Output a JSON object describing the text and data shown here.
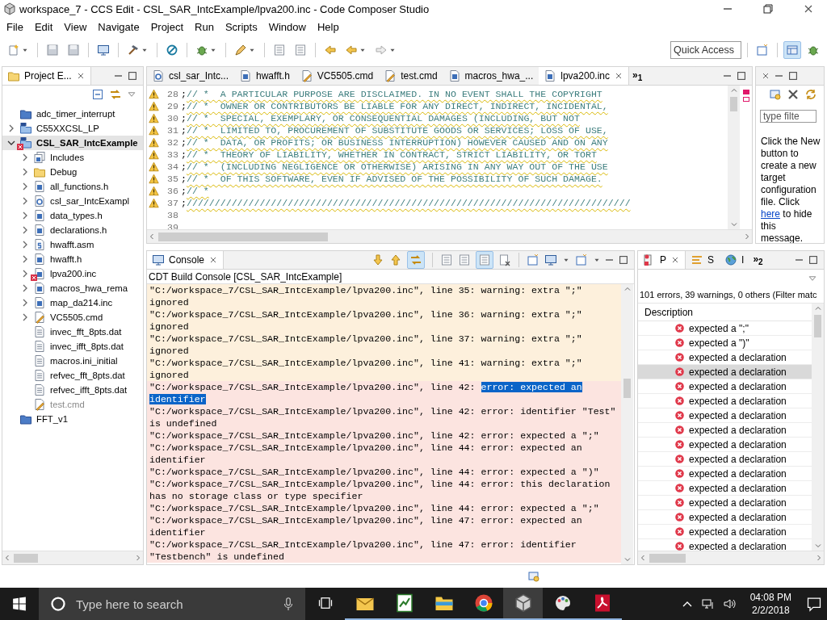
{
  "window": {
    "title": "workspace_7 - CCS Edit - CSL_SAR_IntcExample/lpva200.inc - Code Composer Studio"
  },
  "menu": [
    "File",
    "Edit",
    "View",
    "Navigate",
    "Project",
    "Run",
    "Scripts",
    "Window",
    "Help"
  ],
  "toolbar": {
    "quick_access": {
      "placeholder": "Quick Access"
    }
  },
  "project_explorer": {
    "title": "Project E...",
    "items": [
      {
        "label": "adc_timer_interrupt",
        "kind": "closed-project",
        "selected": false,
        "error": false,
        "excluded": false
      },
      {
        "label": "C55XXCSL_LP",
        "kind": "project",
        "expanded": false,
        "selected": false,
        "error": false,
        "excluded": false
      },
      {
        "label": "CSL_SAR_IntcExample",
        "kind": "project",
        "expanded": true,
        "selected": true,
        "error": true,
        "excluded": false,
        "children": [
          {
            "label": "Includes",
            "kind": "includes",
            "expanded": false,
            "selected": false,
            "error": false,
            "excluded": false
          },
          {
            "label": "Debug",
            "kind": "folder",
            "expanded": false,
            "selected": false,
            "error": false,
            "excluded": false
          },
          {
            "label": "all_functions.h",
            "kind": "h",
            "expanded": false,
            "selected": false,
            "error": false,
            "excluded": false
          },
          {
            "label": "csl_sar_IntcExampl",
            "kind": "c",
            "expanded": false,
            "selected": false,
            "error": false,
            "excluded": false
          },
          {
            "label": "data_types.h",
            "kind": "h",
            "expanded": false,
            "selected": false,
            "error": false,
            "excluded": false
          },
          {
            "label": "declarations.h",
            "kind": "h",
            "expanded": false,
            "selected": false,
            "error": false,
            "excluded": false
          },
          {
            "label": "hwafft.asm",
            "kind": "s",
            "expanded": false,
            "selected": false,
            "error": false,
            "excluded": false
          },
          {
            "label": "hwafft.h",
            "kind": "h",
            "expanded": false,
            "selected": false,
            "error": false,
            "excluded": false
          },
          {
            "label": "lpva200.inc",
            "kind": "h",
            "expanded": false,
            "selected": false,
            "error": true,
            "excluded": false
          },
          {
            "label": "macros_hwa_rema",
            "kind": "h",
            "expanded": false,
            "selected": false,
            "error": false,
            "excluded": false
          },
          {
            "label": "map_da214.inc",
            "kind": "h",
            "expanded": false,
            "selected": false,
            "error": false,
            "excluded": false
          },
          {
            "label": "VC5505.cmd",
            "kind": "cmd",
            "expanded": false,
            "selected": false,
            "error": false,
            "excluded": false
          },
          {
            "label": "invec_fft_8pts.dat",
            "kind": "dat",
            "selected": false,
            "error": false,
            "excluded": false
          },
          {
            "label": "invec_ifft_8pts.dat",
            "kind": "dat",
            "selected": false,
            "error": false,
            "excluded": false
          },
          {
            "label": "macros.ini_initial",
            "kind": "dat",
            "selected": false,
            "error": false,
            "excluded": false
          },
          {
            "label": "refvec_fft_8pts.dat",
            "kind": "dat",
            "selected": false,
            "error": false,
            "excluded": false
          },
          {
            "label": "refvec_ifft_8pts.dat",
            "kind": "dat",
            "selected": false,
            "error": false,
            "excluded": false
          },
          {
            "label": "test.cmd",
            "kind": "cmd",
            "selected": false,
            "error": false,
            "excluded": true
          }
        ]
      },
      {
        "label": "FFT_v1",
        "kind": "closed-project",
        "selected": false,
        "error": false,
        "excluded": false
      }
    ]
  },
  "editor": {
    "tabs": [
      {
        "label": "csl_sar_Intc...",
        "kind": "c",
        "selected": false
      },
      {
        "label": "hwafft.h",
        "kind": "h",
        "selected": false
      },
      {
        "label": "VC5505.cmd",
        "kind": "cmd",
        "selected": false
      },
      {
        "label": "test.cmd",
        "kind": "cmd",
        "selected": false
      },
      {
        "label": "macros_hwa_...",
        "kind": "h",
        "selected": false
      },
      {
        "label": "lpva200.inc",
        "kind": "h",
        "selected": true
      }
    ],
    "overflow": "»$_{1}$",
    "lines": [
      {
        "number": "28",
        "code": ";",
        "comment": "// *  A PARTICULAR PURPOSE ARE DISCLAIMED. IN NO EVENT SHALL THE COPYRIGHT",
        "warning": true
      },
      {
        "number": "29",
        "code": ";",
        "comment": "// *  OWNER OR CONTRIBUTORS BE LIABLE FOR ANY DIRECT, INDIRECT, INCIDENTAL,",
        "warning": true
      },
      {
        "number": "30",
        "code": ";",
        "comment": "// *  SPECIAL, EXEMPLARY, OR CONSEQUENTIAL DAMAGES (INCLUDING, BUT NOT",
        "warning": true
      },
      {
        "number": "31",
        "code": ";",
        "comment": "// *  LIMITED TO, PROCUREMENT OF SUBSTITUTE GOODS OR SERVICES; LOSS OF USE,",
        "warning": true
      },
      {
        "number": "32",
        "code": ";",
        "comment": "// *  DATA, OR PROFITS; OR BUSINESS INTERRUPTION) HOWEVER CAUSED AND ON ANY",
        "warning": true
      },
      {
        "number": "33",
        "code": ";",
        "comment": "// *  THEORY OF LIABILITY, WHETHER IN CONTRACT, STRICT LIABILITY, OR TORT",
        "warning": true
      },
      {
        "number": "34",
        "code": ";",
        "comment": "// *  (INCLUDING NEGLIGENCE OR OTHERWISE) ARISING IN ANY WAY OUT OF THE USE",
        "warning": true
      },
      {
        "number": "35",
        "code": ";",
        "comment": "// *  OF THIS SOFTWARE, EVEN IF ADVISED OF THE POSSIBILITY OF SUCH DAMAGE.",
        "warning": true
      },
      {
        "number": "36",
        "code": ";",
        "comment": "// *",
        "warning": true
      },
      {
        "number": "37",
        "code": ";",
        "comment": "///////////////////////////////////////////////////////////////////////////////",
        "warning": true
      },
      {
        "number": "38",
        "warning": false
      },
      {
        "number": "39",
        "warning": false
      }
    ]
  },
  "target_panel": {
    "filter_placeholder": "type filte",
    "message_before": "Click the New button to create a new target configuration file. Click ",
    "link": "here",
    "message_after": " to hide this message."
  },
  "console": {
    "title": "Console",
    "subtitle": "CDT Build Console [CSL_SAR_IntcExample]",
    "messages": [
      {
        "kind": "warning",
        "text": "\"C:/workspace_7/CSL_SAR_IntcExample/lpva200.inc\", line 35: warning: extra \";\" ignored"
      },
      {
        "kind": "warning",
        "text": "\"C:/workspace_7/CSL_SAR_IntcExample/lpva200.inc\", line 36: warning: extra \";\" ignored"
      },
      {
        "kind": "warning",
        "text": "\"C:/workspace_7/CSL_SAR_IntcExample/lpva200.inc\", line 37: warning: extra \";\" ignored"
      },
      {
        "kind": "warning",
        "text": "\"C:/workspace_7/CSL_SAR_IntcExample/lpva200.inc\", line 41: warning: extra \";\" ignored"
      },
      {
        "kind": "error",
        "text": "\"C:/workspace_7/CSL_SAR_IntcExample/lpva200.inc\", line 42: ",
        "highlight": [
          "error: expected an",
          "identifier"
        ]
      },
      {
        "kind": "error",
        "text": "\"C:/workspace_7/CSL_SAR_IntcExample/lpva200.inc\", line 42: error: identifier \"Test\" is undefined"
      },
      {
        "kind": "error",
        "text": "\"C:/workspace_7/CSL_SAR_IntcExample/lpva200.inc\", line 42: error: expected a \";\""
      },
      {
        "kind": "error",
        "text": "\"C:/workspace_7/CSL_SAR_IntcExample/lpva200.inc\", line 44: error: expected an identifier"
      },
      {
        "kind": "error",
        "text": "\"C:/workspace_7/CSL_SAR_IntcExample/lpva200.inc\", line 44: error: expected a \")\""
      },
      {
        "kind": "error",
        "text": "\"C:/workspace_7/CSL_SAR_IntcExample/lpva200.inc\", line 44: error: this declaration has no storage class or type specifier"
      },
      {
        "kind": "error",
        "text": "\"C:/workspace_7/CSL_SAR_IntcExample/lpva200.inc\", line 44: error: expected a \";\""
      },
      {
        "kind": "error",
        "text": "\"C:/workspace_7/CSL_SAR_IntcExample/lpva200.inc\", line 47: error: expected an identifier"
      },
      {
        "kind": "error",
        "text": "\"C:/workspace_7/CSL_SAR_IntcExample/lpva200.inc\", line 47: error: identifier \"Testbench\" is undefined"
      }
    ]
  },
  "problems": {
    "tabs": [
      {
        "label": "P",
        "kind": "problems",
        "selected": true
      },
      {
        "label": "S",
        "kind": "list",
        "selected": false
      },
      {
        "label": "I",
        "kind": "globe",
        "selected": false
      }
    ],
    "overflow": "»$_{2}$",
    "summary": "101 errors, 39 warnings, 0 others (Filter matc",
    "column": "Description",
    "rows": [
      {
        "text": "expected a \";\"",
        "selected": false
      },
      {
        "text": "expected a \")\"",
        "selected": false
      },
      {
        "text": "expected a declaration",
        "selected": false
      },
      {
        "text": "expected a declaration",
        "selected": true
      },
      {
        "text": "expected a declaration",
        "selected": false
      },
      {
        "text": "expected a declaration",
        "selected": false
      },
      {
        "text": "expected a declaration",
        "selected": false
      },
      {
        "text": "expected a declaration",
        "selected": false
      },
      {
        "text": "expected a declaration",
        "selected": false
      },
      {
        "text": "expected a declaration",
        "selected": false
      },
      {
        "text": "expected a declaration",
        "selected": false
      },
      {
        "text": "expected a declaration",
        "selected": false
      },
      {
        "text": "expected a declaration",
        "selected": false
      },
      {
        "text": "expected a declaration",
        "selected": false
      },
      {
        "text": "expected a declaration",
        "selected": false
      },
      {
        "text": "expected a declaration",
        "selected": false
      }
    ]
  },
  "taskbar": {
    "search_placeholder": "Type here to search",
    "time": "04:08 PM",
    "date": "2/2/2018"
  }
}
